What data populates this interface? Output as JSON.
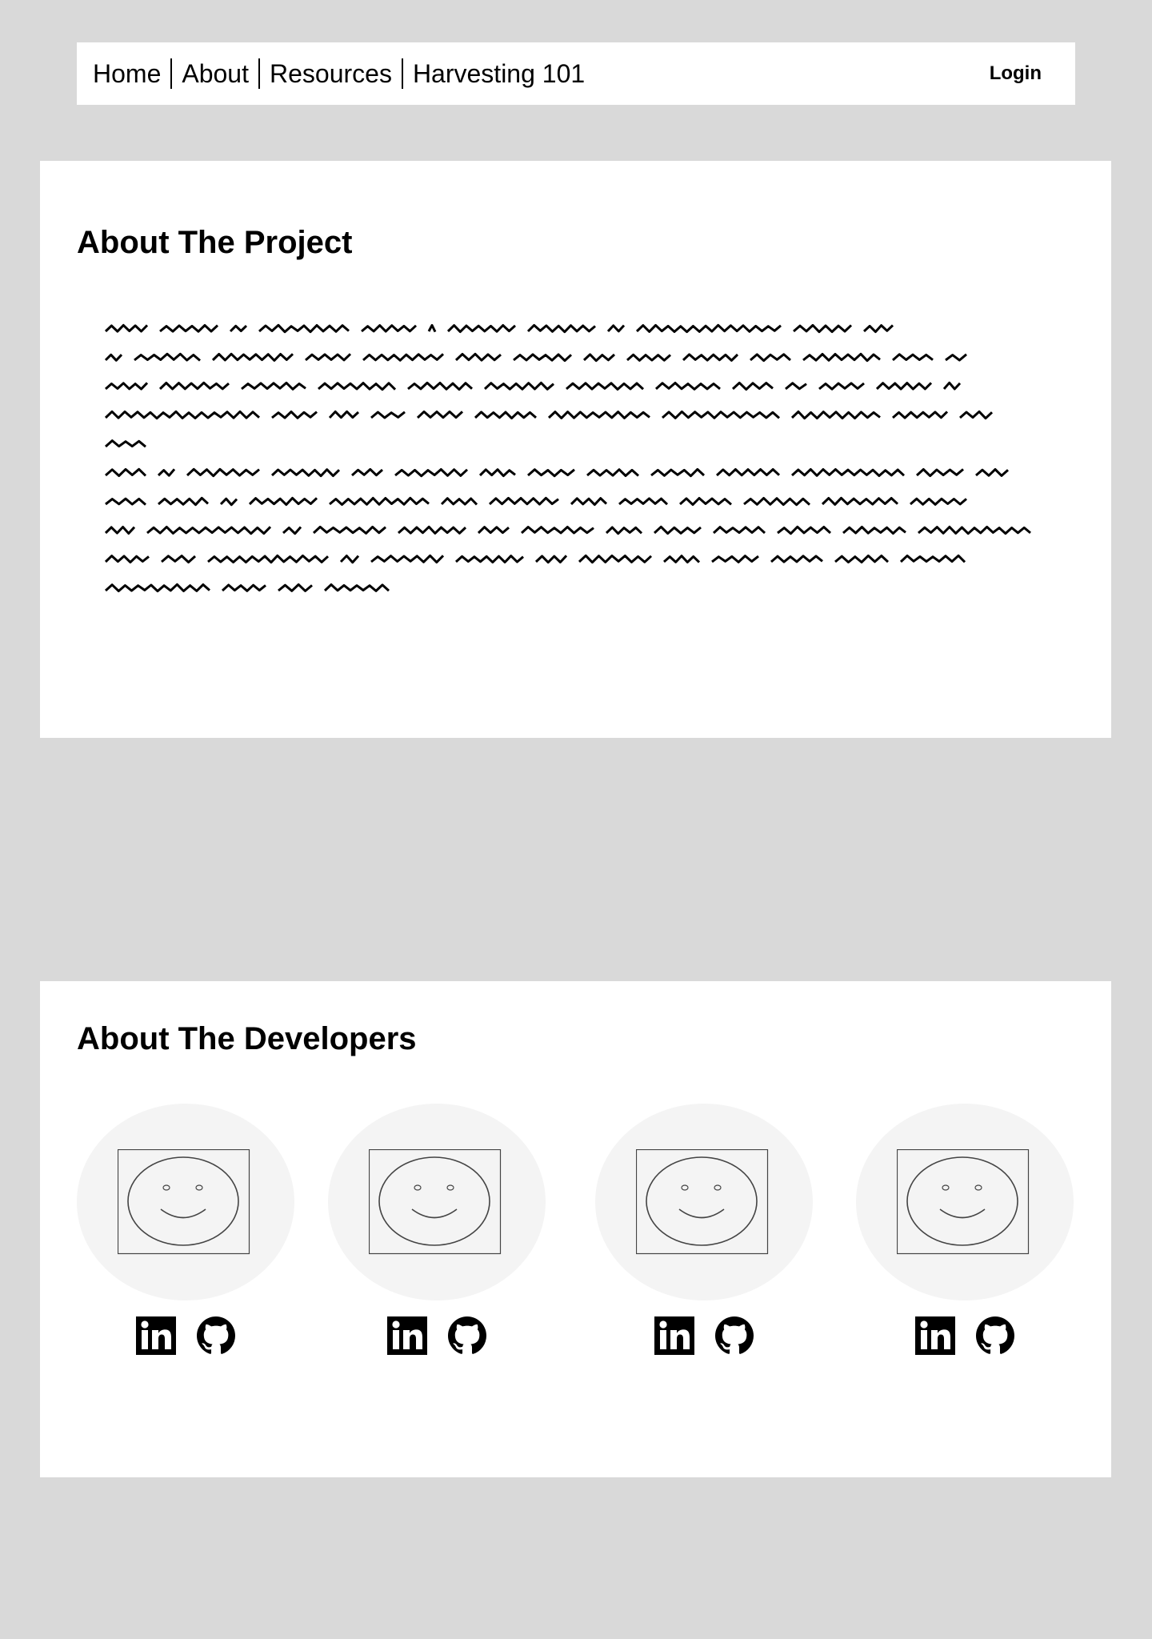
{
  "nav": {
    "links": [
      "Home",
      "About",
      "Resources",
      "Harvesting 101"
    ],
    "login": "Login"
  },
  "project": {
    "title": "About The Project"
  },
  "developers": {
    "title": "About The Developers",
    "cards": [
      {
        "portrait_icon": "smiley-portrait-icon",
        "links": [
          "linkedin-icon",
          "github-icon"
        ]
      },
      {
        "portrait_icon": "smiley-portrait-icon",
        "links": [
          "linkedin-icon",
          "github-icon"
        ]
      },
      {
        "portrait_icon": "smiley-portrait-icon",
        "links": [
          "linkedin-icon",
          "github-icon"
        ]
      },
      {
        "portrait_icon": "smiley-portrait-icon",
        "links": [
          "linkedin-icon",
          "github-icon"
        ]
      }
    ]
  },
  "colors": {
    "page_bg": "#d9d9d9",
    "card_bg": "#ffffff",
    "avatar_bg": "#f4f4f4",
    "text": "#000000"
  }
}
